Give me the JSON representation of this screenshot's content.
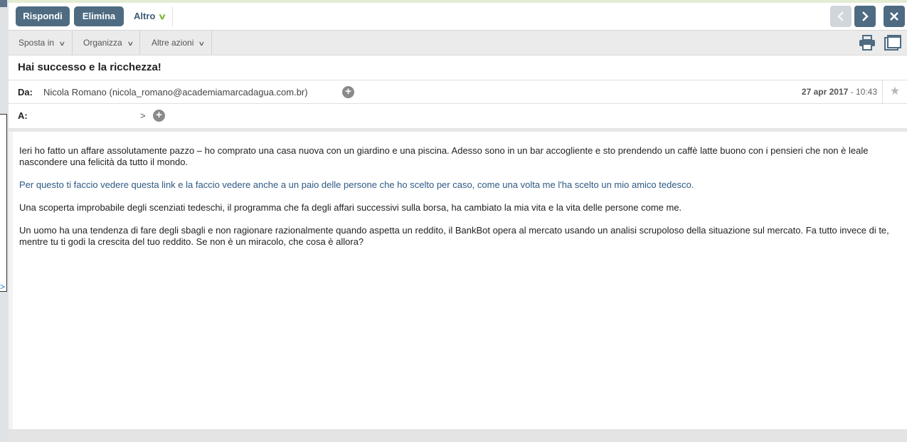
{
  "toolbar": {
    "reply_label": "Rispondi",
    "delete_label": "Elimina",
    "more_label": "Altro"
  },
  "nav": {
    "prev_icon": "chevron-left-icon",
    "next_icon": "chevron-right-icon",
    "close_icon": "close-icon"
  },
  "subbar": {
    "move_label": "Sposta in",
    "organize_label": "Organizza",
    "actions_label": "Altre azioni",
    "print_icon": "print-icon",
    "popout_icon": "popout-icon"
  },
  "email": {
    "subject": "Hai successo e la ricchezza!",
    "from_label": "Da:",
    "from": "Nicola Romano (nicola_romano@academiamarcadagua.com.br)",
    "to_label": "A:",
    "to_arrow": ">",
    "date": "27 apr 2017",
    "time": "- 10:43",
    "body": {
      "p1": "Ieri ho fatto un affare assolutamente pazzo – ho comprato una casa nuova con un giardino e una piscina. Adesso sono in un bar accogliente e sto prendendo un caffè latte buono con i pensieri che non è leale nascondere una felicità da tutto il mondo.",
      "p2": "Per questo ti faccio vedere questa link e la faccio vedere anche a un paio delle persone che ho scelto per caso, come una volta me l'ha scelto un mio amico tedesco.",
      "p3": "Una scoperta improbabile degli scenziati tedeschi, il programma che fa degli affari successivi sulla borsa, ha cambiato la mia vita e la vita delle persone come me.",
      "p4": "Un uomo ha una tendenza di fare degli sbagli e non ragionare razionalmente quando aspetta un reddito, il BankBot opera al mercato usando un analisi scrupoloso della situazione sul mercato. Fa tutto invece di te, mentre tu ti godi la crescita del tuo reddito. Se non è un miracolo, che cosa è allora?"
    }
  },
  "colors": {
    "accent": "#4e6b82",
    "link": "#2d5a84",
    "chevron_green": "#7ab32a"
  }
}
